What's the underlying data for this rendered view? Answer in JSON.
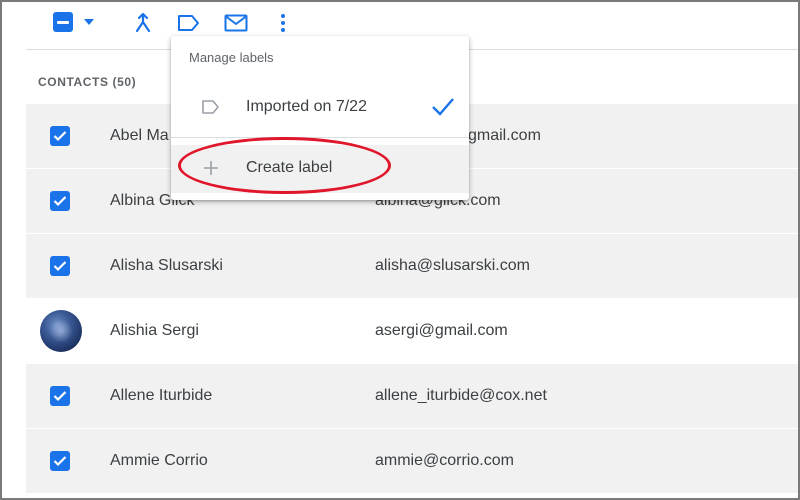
{
  "toolbar": {
    "icons": [
      "select-all-checkbox",
      "caret-down-icon",
      "merge-icon",
      "label-icon",
      "email-icon",
      "more-vert-icon"
    ]
  },
  "list_header": "CONTACTS (50)",
  "menu": {
    "title": "Manage labels",
    "label_item": "Imported on 7/22",
    "create_item": "Create label"
  },
  "contacts": [
    {
      "name": "Abel Ma",
      "email": "gmail.com",
      "selected": true
    },
    {
      "name": "Albina Glick",
      "email": "albina@glick.com",
      "selected": true
    },
    {
      "name": "Alisha Slusarski",
      "email": "alisha@slusarski.com",
      "selected": true
    },
    {
      "name": "Alishia Sergi",
      "email": "asergi@gmail.com",
      "selected": false
    },
    {
      "name": "Allene Iturbide",
      "email": "allene_iturbide@cox.net",
      "selected": true
    },
    {
      "name": "Ammie Corrio",
      "email": "ammie@corrio.com",
      "selected": true
    }
  ],
  "colors": {
    "accent": "#1a73e8",
    "row_selected_bg": "#f1f1f1",
    "annotation": "#e0162b"
  }
}
